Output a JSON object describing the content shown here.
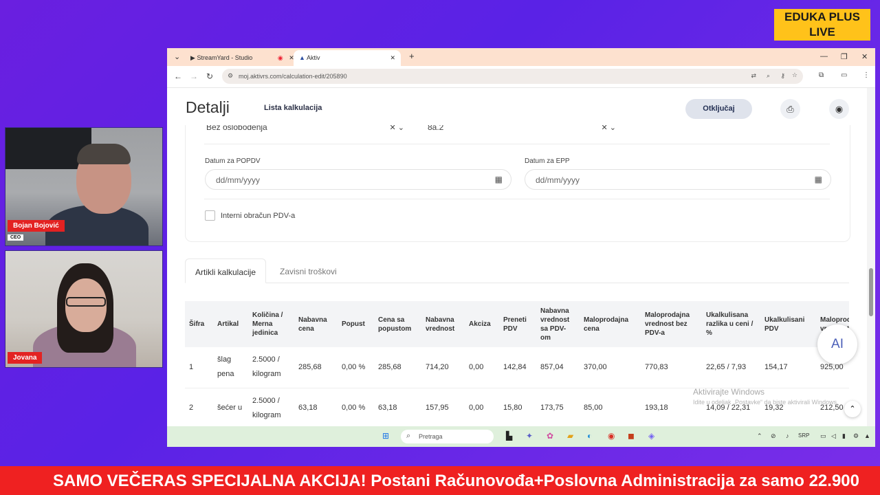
{
  "brand": {
    "line1": "EDUKA PLUS",
    "line2": "LIVE"
  },
  "participants": [
    {
      "name": "Bojan Bojović",
      "role": "CEO"
    },
    {
      "name": "Jovana"
    }
  ],
  "browser": {
    "tabs": [
      {
        "label": "StreamYard - Studio"
      },
      {
        "label": "Aktiv"
      }
    ],
    "url": "moj.aktivrs.com/calculation-edit/205890"
  },
  "page": {
    "title": "Detalji",
    "list_link": "Lista kalkulacija",
    "unlock_label": "Otključaj",
    "select1_value": "Bez oslobođenja",
    "select2_value": "8a.2",
    "popdv_label": "Datum za POPDV",
    "popdv_placeholder": "dd/mm/yyyy",
    "epp_label": "Datum za EPP",
    "epp_placeholder": "dd/mm/yyyy",
    "internal_checkbox_label": "Interni obračun PDV-a",
    "tabs": [
      "Artikli kalkulacije",
      "Zavisni troškovi"
    ],
    "ai_label": "AI"
  },
  "table": {
    "columns": [
      "Šifra",
      "Artikal",
      "Količina / Merna jedinica",
      "Nabavna cena",
      "Popust",
      "Cena sa popustom",
      "Nabavna vrednost",
      "Akciza",
      "Preneti PDV",
      "Nabavna vrednost sa PDV-om",
      "Maloprodajna cena",
      "Maloprodajna vrednost bez PDV-a",
      "Ukalkulisana razlika u ceni / %",
      "Ukalkulisani PDV",
      "Maloprodajna vrednost"
    ],
    "rows": [
      [
        "1",
        "šlag pena",
        "2.5000 / kilogram",
        "285,68",
        "0,00 %",
        "285,68",
        "714,20",
        "0,00",
        "142,84",
        "857,04",
        "370,00",
        "770,83",
        "22,65 / 7,93",
        "154,17",
        "925,00"
      ],
      [
        "2",
        "šećer u",
        "2.5000 / kilogram",
        "63,18",
        "0,00 %",
        "63,18",
        "157,95",
        "0,00",
        "15,80",
        "173,75",
        "85,00",
        "193,18",
        "14,09 / 22,31",
        "19,32",
        "212,50"
      ]
    ]
  },
  "watermark": {
    "line1": "Aktivirajte Windows",
    "line2": "Idite u odeljak „Postavke“ da biste aktivirali Windows."
  },
  "taskbar": {
    "search_placeholder": "Pretraga",
    "lang": "SRP"
  },
  "ticker": "SAMO VEČERAS SPECIJALNA AKCIJA! Postani Računovođa+Poslovna Administracija za samo 22.900"
}
